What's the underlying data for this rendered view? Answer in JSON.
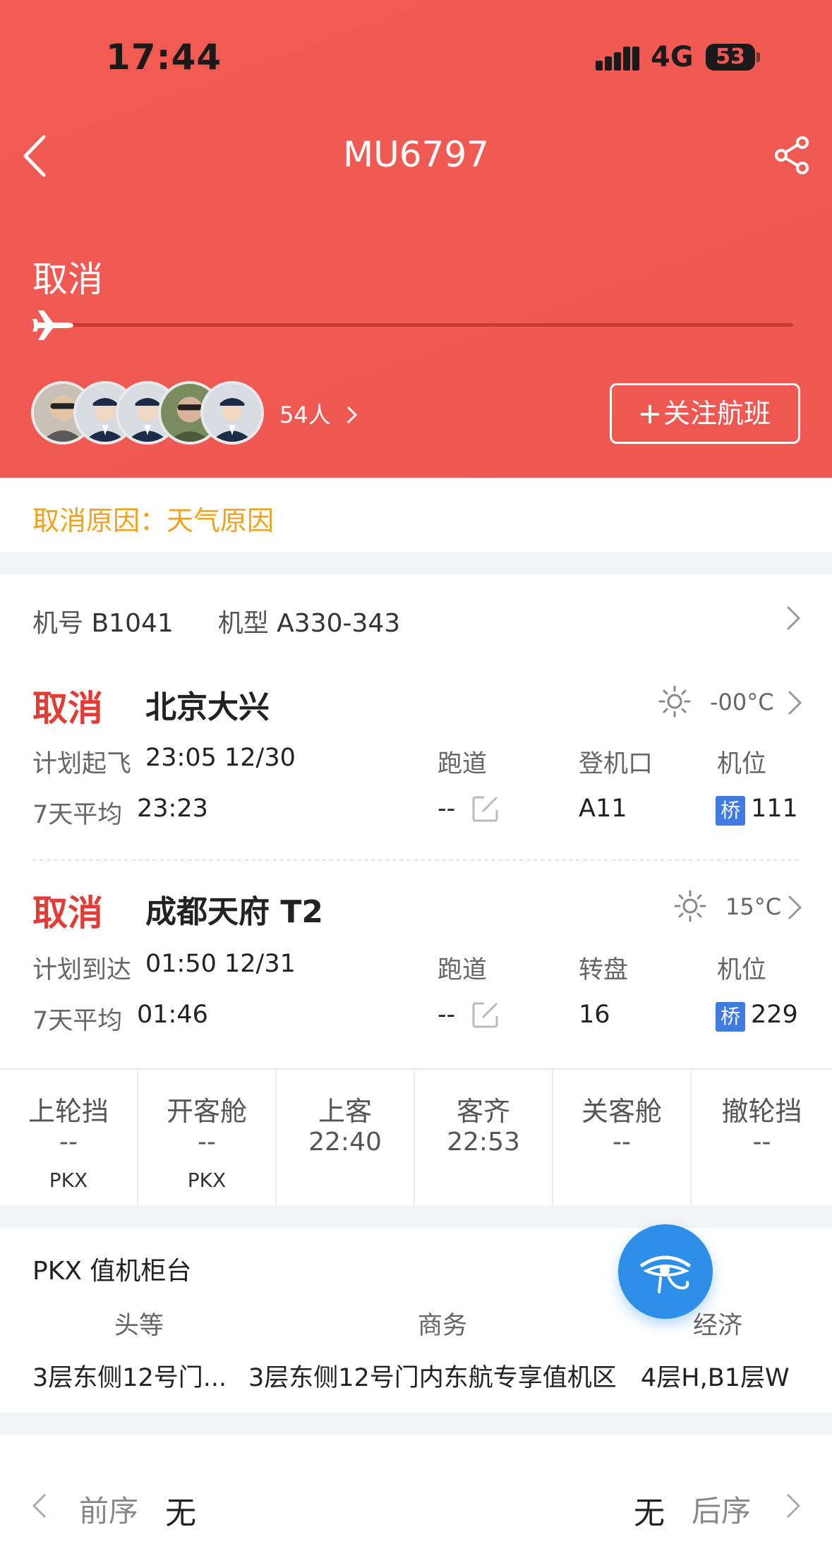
{
  "status_bar": {
    "time": "17:44",
    "network": "4G",
    "battery": "53"
  },
  "nav": {
    "title": "MU6797"
  },
  "flight_status": "取消",
  "social": {
    "followers": "54人",
    "follow_button": "关注航班"
  },
  "cancel_reason": "取消原因：天气原因",
  "aircraft": {
    "reg_label": "机号",
    "reg": "B1041",
    "type_label": "机型",
    "type": "A330-343"
  },
  "departure": {
    "status": "取消",
    "city": "北京大兴",
    "temp": "-00°C",
    "sched_label": "计划起飞",
    "sched": "23:05 12/30",
    "avg_label": "7天平均",
    "avg": "23:23",
    "runway_label": "跑道",
    "runway": "--",
    "gate_label": "登机口",
    "gate": "A11",
    "stand_label": "机位",
    "stand_tag": "桥",
    "stand": "111"
  },
  "arrival": {
    "status": "取消",
    "city": "成都天府 T2",
    "temp": "15°C",
    "sched_label": "计划到达",
    "sched": "01:50 12/31",
    "avg_label": "7天平均",
    "avg": "01:46",
    "runway_label": "跑道",
    "runway": "--",
    "carousel_label": "转盘",
    "carousel": "16",
    "stand_label": "机位",
    "stand_tag": "桥",
    "stand": "229"
  },
  "timeline": [
    {
      "label": "上轮挡",
      "time": "--",
      "airport": "PKX"
    },
    {
      "label": "开客舱",
      "time": "--",
      "airport": "PKX"
    },
    {
      "label": "上客",
      "time": "22:40",
      "airport": ""
    },
    {
      "label": "客齐",
      "time": "22:53",
      "airport": ""
    },
    {
      "label": "关客舱",
      "time": "--",
      "airport": ""
    },
    {
      "label": "撤轮挡",
      "time": "--",
      "airport": ""
    }
  ],
  "checkin": {
    "title": "PKX 值机柜台",
    "first_label": "头等",
    "business_label": "商务",
    "economy_label": "经济",
    "first": "3层东侧12号门...",
    "business": "3层东侧12号门内东航专享值机区",
    "economy": "4层H,B1层W"
  },
  "sequence": {
    "prev_label": "前序",
    "prev": "无",
    "next_label": "后序",
    "next": "无"
  },
  "colors": {
    "header": "#f05a52",
    "cancel": "#e23c36",
    "reason": "#f0a21c",
    "bridge": "#3f7be0",
    "fab": "#2d8fe8"
  },
  "icons": [
    "back-icon",
    "share-icon",
    "plane-icon",
    "chevron-right-icon",
    "sun-icon",
    "edit-icon",
    "eye-of-horus-icon",
    "chevron-left-icon",
    "plus-icon"
  ]
}
